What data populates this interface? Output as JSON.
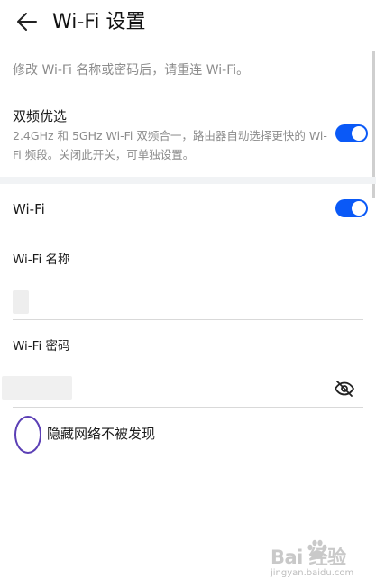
{
  "header": {
    "back_icon": "arrow-left-icon",
    "title": "Wi-Fi 设置"
  },
  "hint": "修改 Wi-Fi 名称或密码后，请重连 Wi-Fi。",
  "dual_band": {
    "title": "双频优选",
    "description": "2.4GHz 和 5GHz Wi-Fi 双频合一，路由器自动选择更快的 Wi-Fi 频段。关闭此开关，可单独设置。",
    "enabled": true
  },
  "wifi": {
    "label": "Wi-Fi",
    "enabled": true
  },
  "wifi_name": {
    "label": "Wi-Fi 名称",
    "value": ""
  },
  "wifi_password": {
    "label": "Wi-Fi 密码",
    "value": "",
    "visibility_icon": "eye-off-icon"
  },
  "hide_network": {
    "label": "隐藏网络不被发现",
    "checked": false
  },
  "watermark": {
    "brand_text": "Bai 经验",
    "url": "jingyan.baidu.com"
  },
  "colors": {
    "accent": "#0a59f7",
    "highlight_circle": "#5b3fb5",
    "secondary_text": "#8c8c8c",
    "divider": "#d9d9d9"
  }
}
